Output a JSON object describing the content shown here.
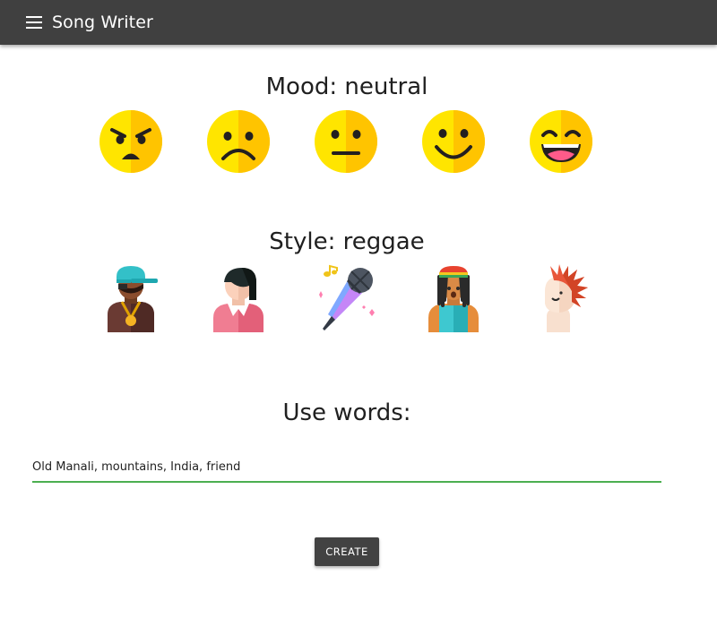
{
  "header": {
    "title": "Song Writer",
    "menu_icon": "hamburger-menu-icon",
    "background": "#404040"
  },
  "mood": {
    "label": "Mood: neutral",
    "options": [
      {
        "name": "angry",
        "icon": "angry-face-icon"
      },
      {
        "name": "sad",
        "icon": "sad-face-icon"
      },
      {
        "name": "neutral",
        "icon": "neutral-face-icon"
      },
      {
        "name": "happy",
        "icon": "smiling-face-icon"
      },
      {
        "name": "joyful",
        "icon": "laughing-face-icon"
      }
    ],
    "selected": "neutral"
  },
  "style": {
    "label": "Style: reggae",
    "options": [
      {
        "name": "hip-hop",
        "icon": "rapper-icon"
      },
      {
        "name": "emo",
        "icon": "emo-person-icon"
      },
      {
        "name": "pop",
        "icon": "microphone-icon"
      },
      {
        "name": "reggae",
        "icon": "rasta-person-icon"
      },
      {
        "name": "punk",
        "icon": "mohawk-punk-icon"
      }
    ],
    "selected": "reggae"
  },
  "words": {
    "label": "Use words:",
    "value": "Old Manali, mountains, India, friend"
  },
  "create_button": {
    "label": "CREATE"
  },
  "colors": {
    "accent_underline": "#4caf50",
    "button": "#424242",
    "emoji_yellow": "#ffd000"
  }
}
